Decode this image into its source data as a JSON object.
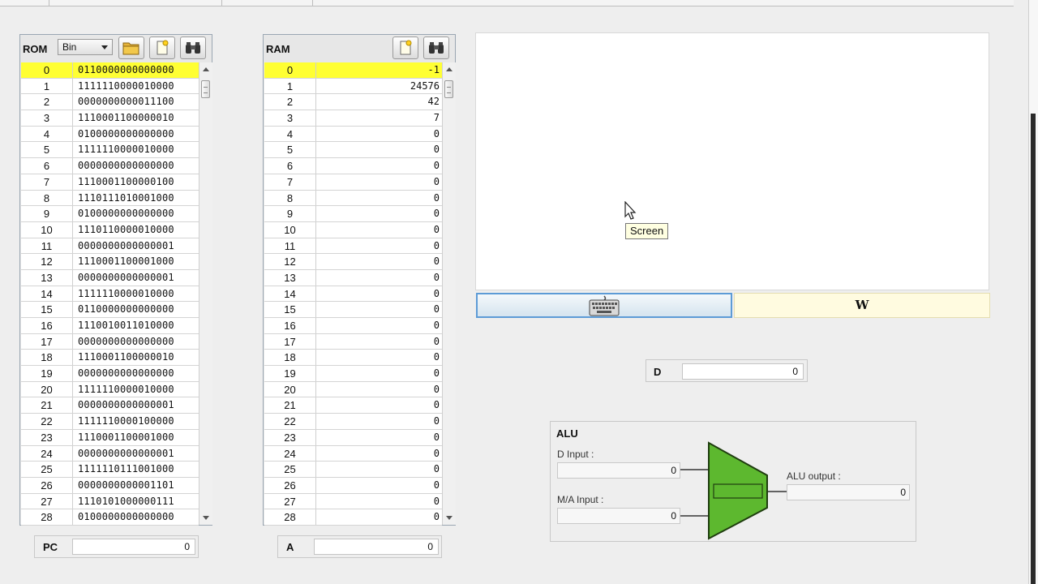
{
  "rom": {
    "title": "ROM",
    "format_selected": "Bin",
    "selected_index": 0,
    "rows": [
      {
        "index": "0",
        "value": "0110000000000000"
      },
      {
        "index": "1",
        "value": "1111110000010000"
      },
      {
        "index": "2",
        "value": "0000000000011100"
      },
      {
        "index": "3",
        "value": "1110001100000010"
      },
      {
        "index": "4",
        "value": "0100000000000000"
      },
      {
        "index": "5",
        "value": "1111110000010000"
      },
      {
        "index": "6",
        "value": "0000000000000000"
      },
      {
        "index": "7",
        "value": "1110001100000100"
      },
      {
        "index": "8",
        "value": "1110111010001000"
      },
      {
        "index": "9",
        "value": "0100000000000000"
      },
      {
        "index": "10",
        "value": "1110110000010000"
      },
      {
        "index": "11",
        "value": "0000000000000001"
      },
      {
        "index": "12",
        "value": "1110001100001000"
      },
      {
        "index": "13",
        "value": "0000000000000001"
      },
      {
        "index": "14",
        "value": "1111110000010000"
      },
      {
        "index": "15",
        "value": "0110000000000000"
      },
      {
        "index": "16",
        "value": "1110010011010000"
      },
      {
        "index": "17",
        "value": "0000000000000000"
      },
      {
        "index": "18",
        "value": "1110001100000010"
      },
      {
        "index": "19",
        "value": "0000000000000000"
      },
      {
        "index": "20",
        "value": "1111110000010000"
      },
      {
        "index": "21",
        "value": "0000000000000001"
      },
      {
        "index": "22",
        "value": "1111110000100000"
      },
      {
        "index": "23",
        "value": "1110001100001000"
      },
      {
        "index": "24",
        "value": "0000000000000001"
      },
      {
        "index": "25",
        "value": "1111110111001000"
      },
      {
        "index": "26",
        "value": "0000000000001101"
      },
      {
        "index": "27",
        "value": "1110101000000111"
      },
      {
        "index": "28",
        "value": "0100000000000000"
      }
    ],
    "scroll_position": 0.0
  },
  "ram": {
    "title": "RAM",
    "selected_index": 0,
    "rows": [
      {
        "index": "0",
        "value": "-1"
      },
      {
        "index": "1",
        "value": "24576"
      },
      {
        "index": "2",
        "value": "42"
      },
      {
        "index": "3",
        "value": "7"
      },
      {
        "index": "4",
        "value": "0"
      },
      {
        "index": "5",
        "value": "0"
      },
      {
        "index": "6",
        "value": "0"
      },
      {
        "index": "7",
        "value": "0"
      },
      {
        "index": "8",
        "value": "0"
      },
      {
        "index": "9",
        "value": "0"
      },
      {
        "index": "10",
        "value": "0"
      },
      {
        "index": "11",
        "value": "0"
      },
      {
        "index": "12",
        "value": "0"
      },
      {
        "index": "13",
        "value": "0"
      },
      {
        "index": "14",
        "value": "0"
      },
      {
        "index": "15",
        "value": "0"
      },
      {
        "index": "16",
        "value": "0"
      },
      {
        "index": "17",
        "value": "0"
      },
      {
        "index": "18",
        "value": "0"
      },
      {
        "index": "19",
        "value": "0"
      },
      {
        "index": "20",
        "value": "0"
      },
      {
        "index": "21",
        "value": "0"
      },
      {
        "index": "22",
        "value": "0"
      },
      {
        "index": "23",
        "value": "0"
      },
      {
        "index": "24",
        "value": "0"
      },
      {
        "index": "25",
        "value": "0"
      },
      {
        "index": "26",
        "value": "0"
      },
      {
        "index": "27",
        "value": "0"
      },
      {
        "index": "28",
        "value": "0"
      }
    ],
    "scroll_position": 0.0
  },
  "registers": {
    "pc": {
      "label": "PC",
      "value": "0"
    },
    "a": {
      "label": "A",
      "value": "0"
    },
    "d": {
      "label": "D",
      "value": "0"
    }
  },
  "screen": {
    "tooltip": "Screen"
  },
  "keyboard": {
    "icon": "keyboard-icon",
    "current_key": "W"
  },
  "alu": {
    "title": "ALU",
    "d_input_label": "D Input :",
    "d_input_value": "0",
    "ma_input_label": "M/A Input :",
    "ma_input_value": "0",
    "output_label": "ALU output :",
    "output_value": "0",
    "color": "#5db82f"
  },
  "colors": {
    "highlight": "#ffff33",
    "keyboard_focus": "#5d9bd6",
    "keyboard_display_bg": "#fffbe0"
  }
}
